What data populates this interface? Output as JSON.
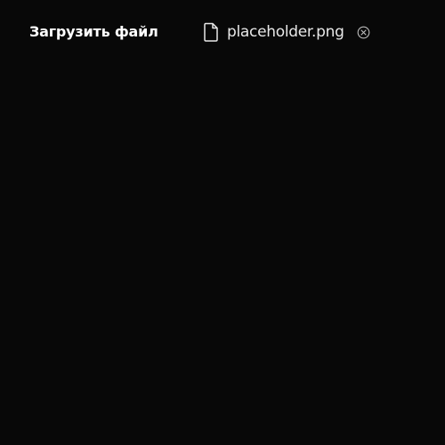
{
  "upload": {
    "button_label": "Загрузить файл"
  },
  "file": {
    "name": "placeholder.png",
    "icon": "file-icon",
    "remove_icon": "circle-x-icon"
  },
  "colors": {
    "background": "#080808",
    "text": "#ffffff",
    "muted_icon": "#bdbdbd"
  }
}
